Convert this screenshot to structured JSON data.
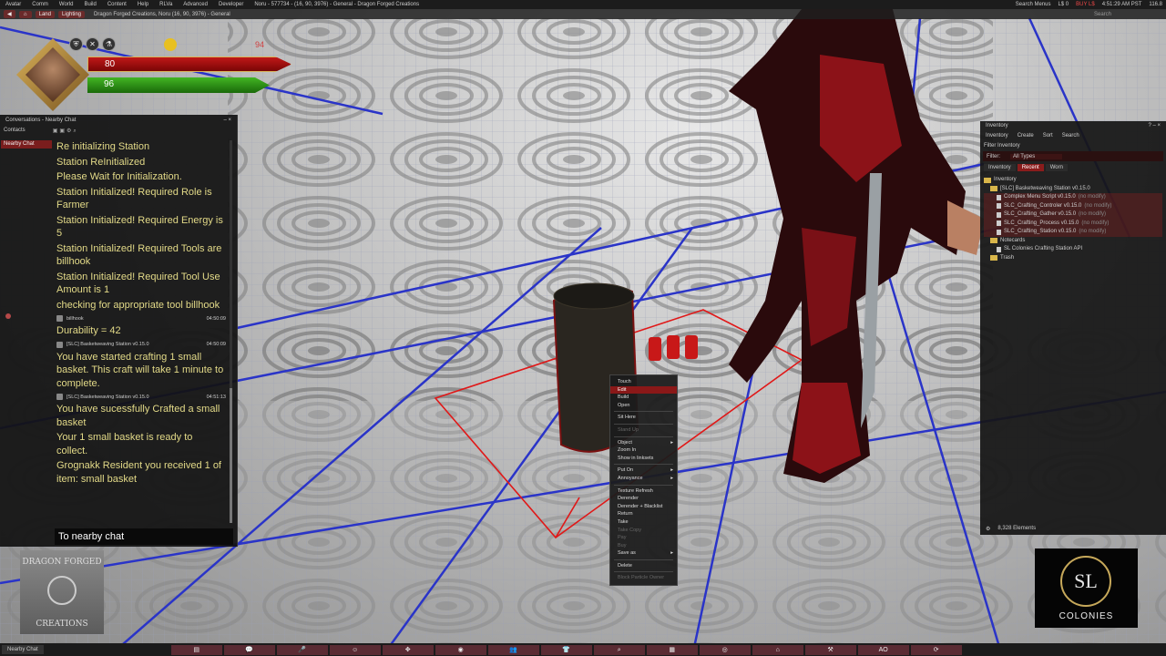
{
  "menubar": {
    "items": [
      "Avatar",
      "Comm",
      "World",
      "Build",
      "Content",
      "Help",
      "RLVa",
      "Advanced",
      "Developer"
    ],
    "location": "Noru - 577734 - (16, 90, 3976) - General - Dragon Forged Creations",
    "search": "Search Menus",
    "balance": "L$ 0",
    "buy": "BUY L$",
    "time": "4:51:29 AM PST",
    "fps": "116.8"
  },
  "locbar": {
    "land": "Land",
    "lighting": "Lighting",
    "location": "Dragon Forged Creations, Noru (16, 90, 3976) - General",
    "search": "Search"
  },
  "hud": {
    "health": "80",
    "energy": "96",
    "extra": "94",
    "icons": [
      "shield-icon",
      "tools-icon",
      "flask-icon",
      "coin-icon"
    ]
  },
  "conversations": {
    "title": "Conversations - Nearby Chat",
    "contacts": "Contacts",
    "nearby_tab": "Nearby Chat",
    "messages": [
      {
        "type": "msg",
        "text": "Re initializing Station"
      },
      {
        "type": "msg",
        "text": "Station ReInitialized"
      },
      {
        "type": "msg",
        "text": "Please Wait for Initialization."
      },
      {
        "type": "msg",
        "text": "Station Initialized! Required Role is Farmer"
      },
      {
        "type": "msg",
        "text": "Station Initialized! Required Energy is 5"
      },
      {
        "type": "msg",
        "text": "Station Initialized! Required Tools are billhook"
      },
      {
        "type": "msg",
        "text": "Station Initialized! Required Tool Use Amount is 1"
      },
      {
        "type": "msg",
        "text": "checking for appropriate tool billhook"
      },
      {
        "type": "meta",
        "sender": "billhook",
        "time": "04:50:09"
      },
      {
        "type": "msg",
        "text": "Durability = 42"
      },
      {
        "type": "meta",
        "sender": "[SLC] Basketweaving Station v0.15.0",
        "time": "04:50:09"
      },
      {
        "type": "msg",
        "text": "You have started crafting 1 small basket. This craft will take  1 minute to complete."
      },
      {
        "type": "meta",
        "sender": "[SLC] Basketweaving Station v0.15.0",
        "time": "04:51:13"
      },
      {
        "type": "msg",
        "text": "You have sucessfully Crafted a small basket"
      },
      {
        "type": "msg",
        "text": "Your 1 small basket is ready to collect."
      },
      {
        "type": "msg",
        "text": "Grognakk Resident you received 1 of item: small basket"
      }
    ],
    "input_placeholder": "To nearby chat"
  },
  "inventory": {
    "title": "Inventory",
    "menu": [
      "Inventory",
      "Create",
      "Sort",
      "Search"
    ],
    "filter_inventory": "Filter Inventory",
    "filter_label": "Filter:",
    "filter_value": "All Types",
    "tabs": [
      "Inventory",
      "Recent",
      "Worn"
    ],
    "tree": [
      {
        "kind": "folder",
        "label": "Inventory",
        "indent": 0,
        "note": ""
      },
      {
        "kind": "folder",
        "label": "[SLC] Basketweaving Station v0.15.0",
        "indent": 1,
        "note": ""
      },
      {
        "kind": "item",
        "label": "Complex Menu Script v0.15.0",
        "indent": 2,
        "note": "(no modify)"
      },
      {
        "kind": "item",
        "label": "SLC_Crafting_Controler v0.15.0",
        "indent": 2,
        "note": "(no modify)"
      },
      {
        "kind": "item",
        "label": "SLC_Crafting_Gather v0.15.0",
        "indent": 2,
        "note": "(no modify)"
      },
      {
        "kind": "item",
        "label": "SLC_Crafting_Process v0.15.0",
        "indent": 2,
        "note": "(no modify)"
      },
      {
        "kind": "item",
        "label": "SLC_Crafting_Station v0.15.0",
        "indent": 2,
        "note": "(no modify)"
      },
      {
        "kind": "folder",
        "label": "Notecards",
        "indent": 1,
        "note": ""
      },
      {
        "kind": "item",
        "label": "SL Colonies Crafting Station API",
        "indent": 2,
        "note": ""
      },
      {
        "kind": "folder",
        "label": "Trash",
        "indent": 1,
        "note": ""
      }
    ],
    "status": "8,328 Elements"
  },
  "context_menu": {
    "items": [
      {
        "label": "Touch",
        "state": "normal",
        "sub": false
      },
      {
        "label": "Edit",
        "state": "hover",
        "sub": false
      },
      {
        "label": "Build",
        "state": "normal",
        "sub": false
      },
      {
        "label": "Open",
        "state": "normal",
        "sub": false
      },
      {
        "label": "-"
      },
      {
        "label": "Sit Here",
        "state": "normal",
        "sub": false
      },
      {
        "label": "-"
      },
      {
        "label": "Stand Up",
        "state": "disabled",
        "sub": false
      },
      {
        "label": "-"
      },
      {
        "label": "Object",
        "state": "normal",
        "sub": true
      },
      {
        "label": "Zoom In",
        "state": "normal",
        "sub": false
      },
      {
        "label": "Show in linksets",
        "state": "normal",
        "sub": false
      },
      {
        "label": "-"
      },
      {
        "label": "Put On",
        "state": "normal",
        "sub": true
      },
      {
        "label": "Annoyance",
        "state": "normal",
        "sub": true
      },
      {
        "label": "-"
      },
      {
        "label": "Texture Refresh",
        "state": "normal",
        "sub": false
      },
      {
        "label": "Derender",
        "state": "normal",
        "sub": false
      },
      {
        "label": "Derender + Blacklist",
        "state": "normal",
        "sub": false
      },
      {
        "label": "Return",
        "state": "normal",
        "sub": false
      },
      {
        "label": "Take",
        "state": "normal",
        "sub": false
      },
      {
        "label": "Take Copy",
        "state": "disabled",
        "sub": false
      },
      {
        "label": "Pay",
        "state": "disabled",
        "sub": false
      },
      {
        "label": "Buy",
        "state": "disabled",
        "sub": false
      },
      {
        "label": "Save as",
        "state": "normal",
        "sub": true
      },
      {
        "label": "-"
      },
      {
        "label": "Delete",
        "state": "normal",
        "sub": false
      },
      {
        "label": "-"
      },
      {
        "label": "Block Particle Owner",
        "state": "disabled",
        "sub": false
      }
    ]
  },
  "logos": {
    "dfc_top": "DRAGON FORGED",
    "dfc_bottom": "CREATIONS",
    "slc_mark": "SL",
    "slc_word": "COLONIES"
  },
  "bottombar": {
    "nearby_chat": "Nearby Chat",
    "toolbar_icons": [
      "inventory-icon",
      "chat-icon",
      "voice-icon",
      "gestures-icon",
      "move-icon",
      "view-icon",
      "people-icon",
      "appearance-icon",
      "search-icon",
      "map-icon",
      "minimap-icon",
      "places-icon",
      "build-icon",
      "ao-icon",
      "fs-icon"
    ],
    "ao_label": "AO"
  },
  "colors": {
    "accent_red": "#8a1818",
    "chat_text": "#e3da88",
    "health": "#c01818",
    "energy": "#42b523"
  }
}
